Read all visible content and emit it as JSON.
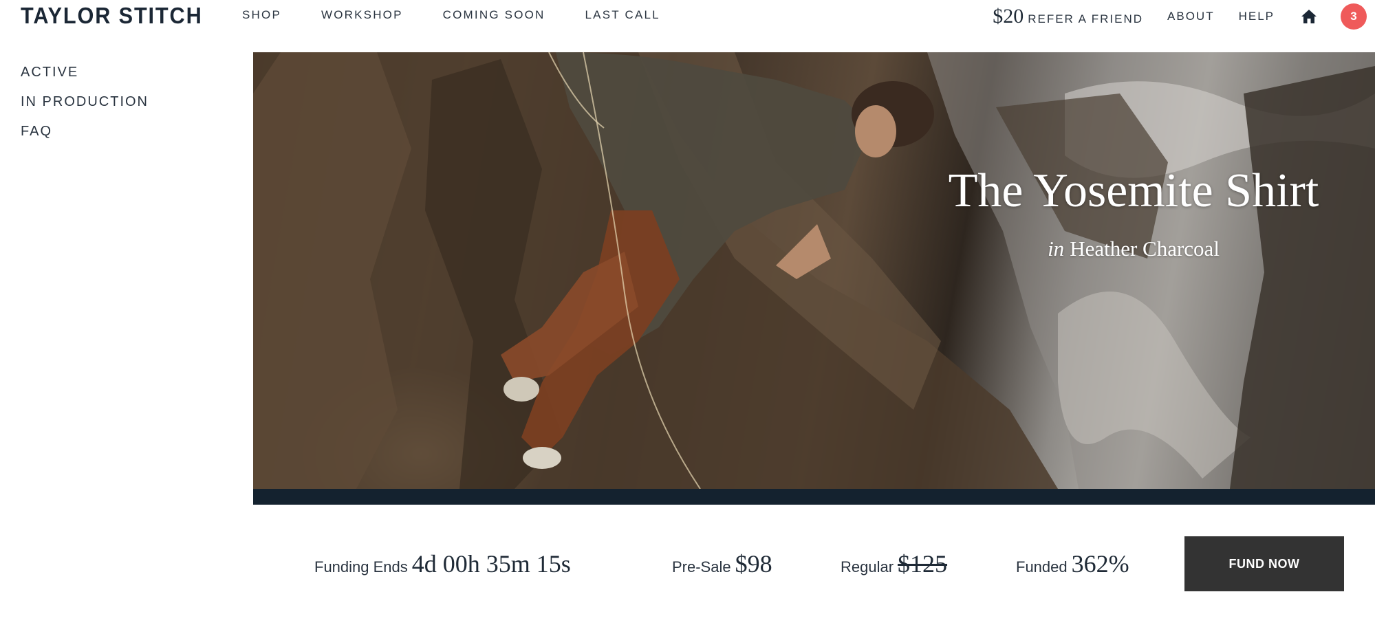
{
  "header": {
    "logo": "TAYLOR STITCH",
    "nav": [
      "SHOP",
      "WORKSHOP",
      "COMING SOON",
      "LAST CALL"
    ],
    "refer_amount": "$20",
    "refer_label": "REFER A FRIEND",
    "about": "ABOUT",
    "help": "HELP",
    "cart_count": "3",
    "badge_color": "#ef5a5a"
  },
  "sidebar": {
    "items": [
      "ACTIVE",
      "IN PRODUCTION",
      "FAQ"
    ]
  },
  "hero": {
    "title": "The Yosemite Shirt",
    "subtitle_prefix": "in",
    "subtitle_color": "Heather Charcoal",
    "band_color": "#14222f"
  },
  "stats": {
    "funding_label": "Funding Ends",
    "funding_value": "4d 00h 35m 15s",
    "presale_label": "Pre-Sale",
    "presale_value": "$98",
    "regular_label": "Regular",
    "regular_value": "$125",
    "funded_label": "Funded",
    "funded_value": "362%"
  },
  "cta": {
    "label": "FUND NOW",
    "color": "#333333"
  }
}
